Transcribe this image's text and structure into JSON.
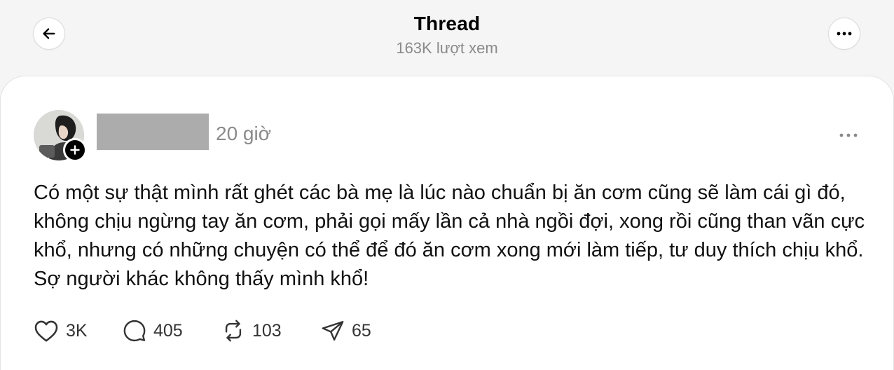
{
  "header": {
    "title": "Thread",
    "views": "163K lượt xem",
    "back_icon": "arrow-left-icon",
    "more_icon": "more-horizontal-icon"
  },
  "post": {
    "time": "20 giờ",
    "text": "Có một sự thật mình rất ghét các bà mẹ là lúc nào chuẩn bị ăn cơm cũng sẽ làm cái gì đó, không chịu ngừng tay ăn cơm, phải gọi mấy lần cả nhà ngồi đợi, xong rồi cũng than vãn cực khổ, nhưng có những chuyện có thể để đó ăn cơm xong mới làm tiếp, tư duy thích chịu khổ. Sợ người khác không thấy mình khổ!",
    "actions": {
      "likes": "3K",
      "replies": "405",
      "reposts": "103",
      "shares": "65"
    }
  },
  "colors": {
    "background": "#f5f5f5",
    "card": "#ffffff",
    "muted_text": "#8a8a8a",
    "redacted": "#acacac"
  }
}
